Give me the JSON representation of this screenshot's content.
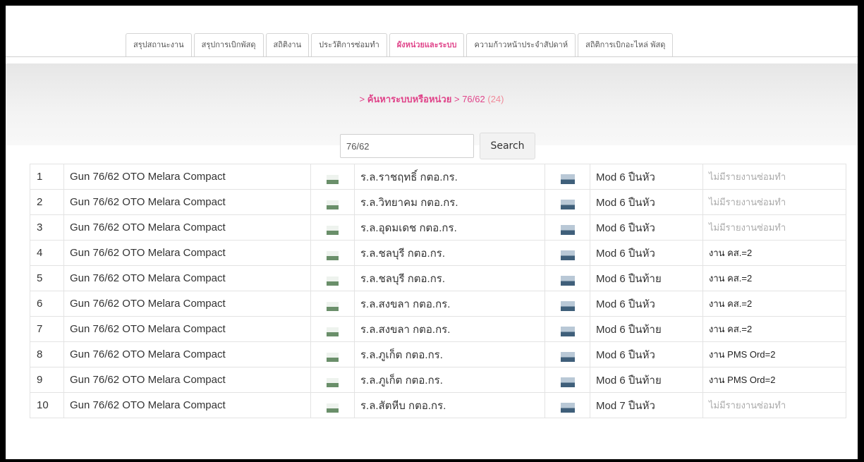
{
  "tabs": [
    {
      "label": "สรุปสถานะงาน",
      "active": false
    },
    {
      "label": "สรุปการเบิกพัสดุ",
      "active": false
    },
    {
      "label": "สถิติงาน",
      "active": false
    },
    {
      "label": "ประวัติการซ่อมทำ",
      "active": false
    },
    {
      "label": "ผังหน่วยและระบบ",
      "active": true
    },
    {
      "label": "ความก้าวหน้าประจำสัปดาห์",
      "active": false
    },
    {
      "label": "สถิติการเบิกอะไหล่ พัสดุ",
      "active": false
    }
  ],
  "breadcrumb": {
    "prefix": ">",
    "link": "ค้นหาระบบหรือหน่วย",
    "separator": ">",
    "current": "76/62",
    "count": "(24)"
  },
  "search": {
    "value": "76/62",
    "button_label": "Search"
  },
  "rows": [
    {
      "num": "1",
      "system": "Gun 76/62 OTO Melara Compact",
      "ship": "ร.ล.ราชฤทธิ์ กตอ.กร.",
      "mod": "Mod 6 ปืนหัว",
      "status": "ไม่มีรายงานซ่อมทำ"
    },
    {
      "num": "2",
      "system": "Gun 76/62 OTO Melara Compact",
      "ship": "ร.ล.วิทยาคม กตอ.กร.",
      "mod": "Mod 6 ปืนหัว",
      "status": "ไม่มีรายงานซ่อมทำ"
    },
    {
      "num": "3",
      "system": "Gun 76/62 OTO Melara Compact",
      "ship": "ร.ล.อุดมเดช กตอ.กร.",
      "mod": "Mod 6 ปืนหัว",
      "status": "ไม่มีรายงานซ่อมทำ"
    },
    {
      "num": "4",
      "system": "Gun 76/62 OTO Melara Compact",
      "ship": "ร.ล.ชลบุรี กตอ.กร.",
      "mod": "Mod 6 ปืนหัว",
      "status": "งาน คส.=2"
    },
    {
      "num": "5",
      "system": "Gun 76/62 OTO Melara Compact",
      "ship": "ร.ล.ชลบุรี กตอ.กร.",
      "mod": "Mod 6 ปืนท้าย",
      "status": "งาน คส.=2"
    },
    {
      "num": "6",
      "system": "Gun 76/62 OTO Melara Compact",
      "ship": "ร.ล.สงขลา กตอ.กร.",
      "mod": "Mod 6 ปืนหัว",
      "status": "งาน คส.=2"
    },
    {
      "num": "7",
      "system": "Gun 76/62 OTO Melara Compact",
      "ship": "ร.ล.สงขลา กตอ.กร.",
      "mod": "Mod 6 ปืนท้าย",
      "status": "งาน คส.=2"
    },
    {
      "num": "8",
      "system": "Gun 76/62 OTO Melara Compact",
      "ship": "ร.ล.ภูเก็ต กตอ.กร.",
      "mod": "Mod 6 ปืนหัว",
      "status": "งาน PMS Ord=2"
    },
    {
      "num": "9",
      "system": "Gun 76/62 OTO Melara Compact",
      "ship": "ร.ล.ภูเก็ต กตอ.กร.",
      "mod": "Mod 6 ปืนท้าย",
      "status": "งาน PMS Ord=2"
    },
    {
      "num": "10",
      "system": "Gun 76/62 OTO Melara Compact",
      "ship": "ร.ล.สัตหีบ กตอ.กร.",
      "mod": "Mod 7 ปืนหัว",
      "status": "ไม่มีรายงานซ่อมทำ"
    }
  ],
  "icons": {
    "system_thumb": "gun-thumbnail-icon",
    "ship_thumb": "ship-thumbnail-icon"
  },
  "colors": {
    "accent": "#e0448a",
    "muted_status": "#aaaaaa"
  }
}
